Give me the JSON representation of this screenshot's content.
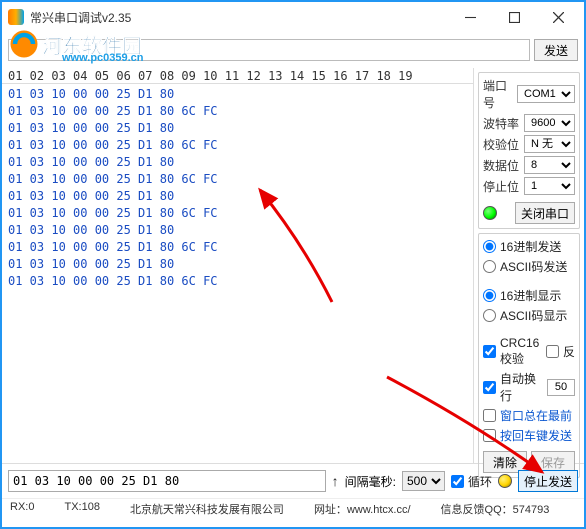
{
  "window": {
    "title": "常兴串口调试v2.35"
  },
  "toolbar": {
    "send": "发送"
  },
  "hex_header": "01 02 03 04 05 06 07 08 09 10 11 12 13 14 15 16 17 18 19",
  "hex_lines": [
    "01 03 10 00 00 25 D1 80",
    "01 03 10 00 00 25 D1 80 6C FC",
    "01 03 10 00 00 25 D1 80",
    "01 03 10 00 00 25 D1 80 6C FC",
    "01 03 10 00 00 25 D1 80",
    "01 03 10 00 00 25 D1 80 6C FC",
    "01 03 10 00 00 25 D1 80",
    "01 03 10 00 00 25 D1 80 6C FC",
    "01 03 10 00 00 25 D1 80",
    "01 03 10 00 00 25 D1 80 6C FC",
    "01 03 10 00 00 25 D1 80",
    "01 03 10 00 00 25 D1 80 6C FC"
  ],
  "port": {
    "port_lbl": "端口号",
    "port_val": "COM1",
    "baud_lbl": "波特率",
    "baud_val": "9600",
    "parity_lbl": "校验位",
    "parity_val": "N 无",
    "data_lbl": "数据位",
    "data_val": "8",
    "stop_lbl": "停止位",
    "stop_val": "1",
    "close_btn": "关闭串口"
  },
  "send_opts": {
    "hex": "16进制发送",
    "ascii": "ASCII码发送"
  },
  "disp_opts": {
    "hex": "16进制显示",
    "ascii": "ASCII码显示"
  },
  "flags": {
    "crc": "CRC16校验",
    "reflect": "反",
    "wrap": "自动换行",
    "wrap_val": "50",
    "topmost": "窗口总在最前",
    "enter_send": "按回车键发送"
  },
  "actions": {
    "clear": "清除",
    "save": "保存"
  },
  "sendbar": {
    "value": "01 03 10 00 00 25 D1 80",
    "interval_lbl": "间隔毫秒:",
    "interval_val": "500",
    "loop": "循环",
    "stop_send": "停止发送"
  },
  "status": {
    "rx": "RX:0",
    "tx": "TX:108",
    "company": "北京航天常兴科技发展有限公司",
    "site_lbl": "网址：",
    "site": "www.htcx.cc/",
    "qq_lbl": "信息反馈QQ：",
    "qq": "574793"
  },
  "watermark": {
    "brand": "河东软件园",
    "url": "www.pc0359.cn"
  }
}
